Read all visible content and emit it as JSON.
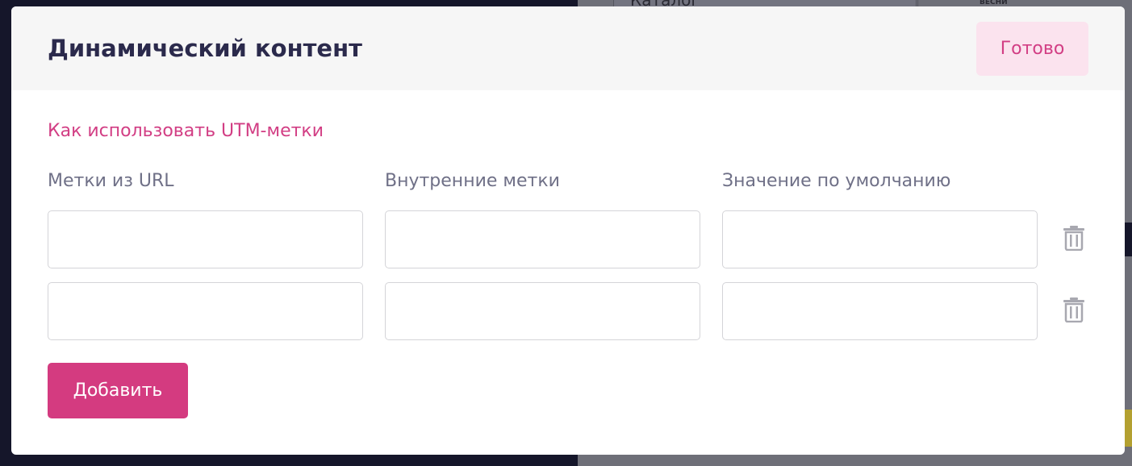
{
  "background_page": {
    "catalog_select_label": "Каталог",
    "logo_text": "ВЕСНИ"
  },
  "modal": {
    "title": "Динамический контент",
    "done_label": "Готово",
    "utm_help_link": "Как использовать UTM-метки",
    "columns": {
      "url_tags": "Метки из URL",
      "internal_tags": "Внутренние метки",
      "default_value": "Значение по умолчанию"
    },
    "rows": [
      {
        "url_tag": "",
        "internal_tag": "",
        "default_value": ""
      },
      {
        "url_tag": "",
        "internal_tag": "",
        "default_value": ""
      }
    ],
    "add_label": "Добавить"
  },
  "colors": {
    "accent": "#d43b80",
    "accent_light": "#fbe3ee",
    "title": "#2b2a4c",
    "label": "#6f7087",
    "icon": "#a8a8b0"
  },
  "icons": {
    "delete_row": "trash-icon",
    "select_caret": "chevron-down-icon"
  }
}
